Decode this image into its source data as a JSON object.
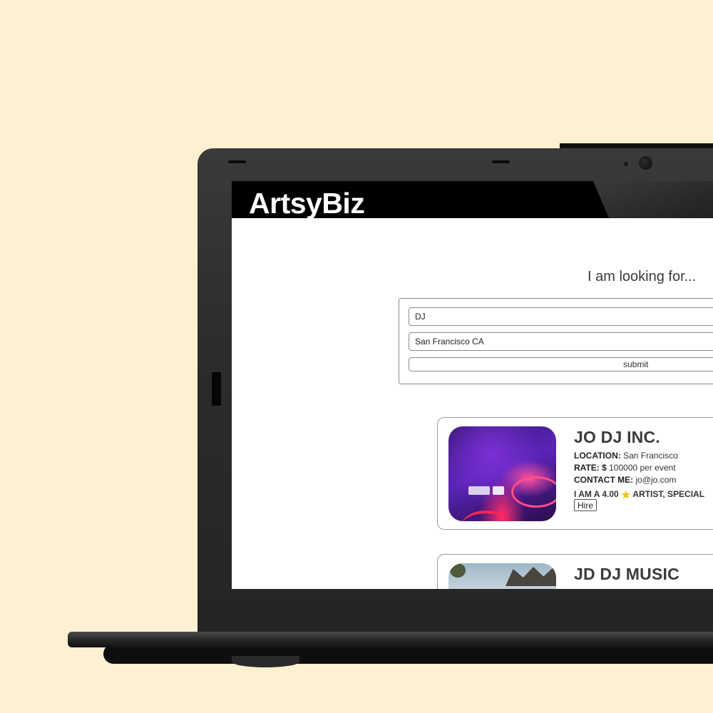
{
  "app": {
    "brand": "ArtsyBiz"
  },
  "search": {
    "heading": "I am looking for...",
    "category_value": "DJ",
    "location_value": "San Francisco CA",
    "submit_label": "submit"
  },
  "results": [
    {
      "name": "JO DJ INC.",
      "location_label": "LOCATION:",
      "location": "San Francisco",
      "rate_label": "RATE: $",
      "rate": "100000 per event",
      "contact_label": "CONTACT ME:",
      "contact": "jo@jo.com",
      "rating_prefix": "I AM A 4.00",
      "rating_suffix": "ARTIST, SPECIAL",
      "hire_label": "Hire",
      "image_icon": "dj-turntable-photo"
    },
    {
      "name": "JD DJ MUSIC",
      "image_icon": "street-photo"
    }
  ],
  "colors": {
    "background": "#fdf1d2",
    "navbar": "#000000",
    "star": "#f2c21b"
  }
}
